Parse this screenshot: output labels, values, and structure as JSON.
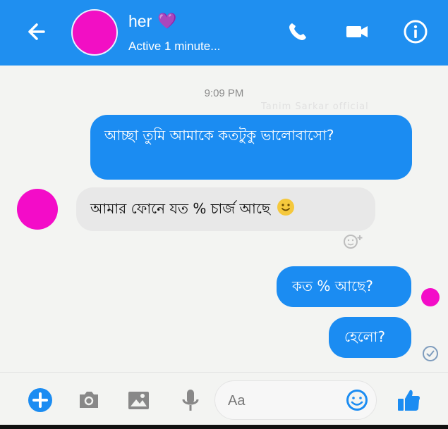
{
  "header": {
    "name": "her",
    "heart": "💜",
    "status": "Active 1 minute...",
    "icons": [
      "back-arrow-icon",
      "phone-icon",
      "video-camera-icon",
      "info-icon"
    ]
  },
  "conversation": {
    "timestamp": "9:09 PM",
    "watermark": "Tanim Sarkar official",
    "messages": [
      {
        "sender": "me",
        "text": "আচ্ছা তুমি আমাকে কতটুকু ভালোবাসো?"
      },
      {
        "sender": "her",
        "text": "আমার ফোনে যত % চার্জ আছে"
      },
      {
        "sender": "me",
        "text": "কত % আছে?"
      },
      {
        "sender": "me",
        "text": "হেলো?"
      }
    ]
  },
  "composer": {
    "placeholder": "Aa"
  },
  "colors": {
    "header": "#1f8ff0",
    "sent_bubble": "#1b8cf2",
    "received_bubble": "#e8e8e8",
    "avatar": "#f20fc4"
  }
}
